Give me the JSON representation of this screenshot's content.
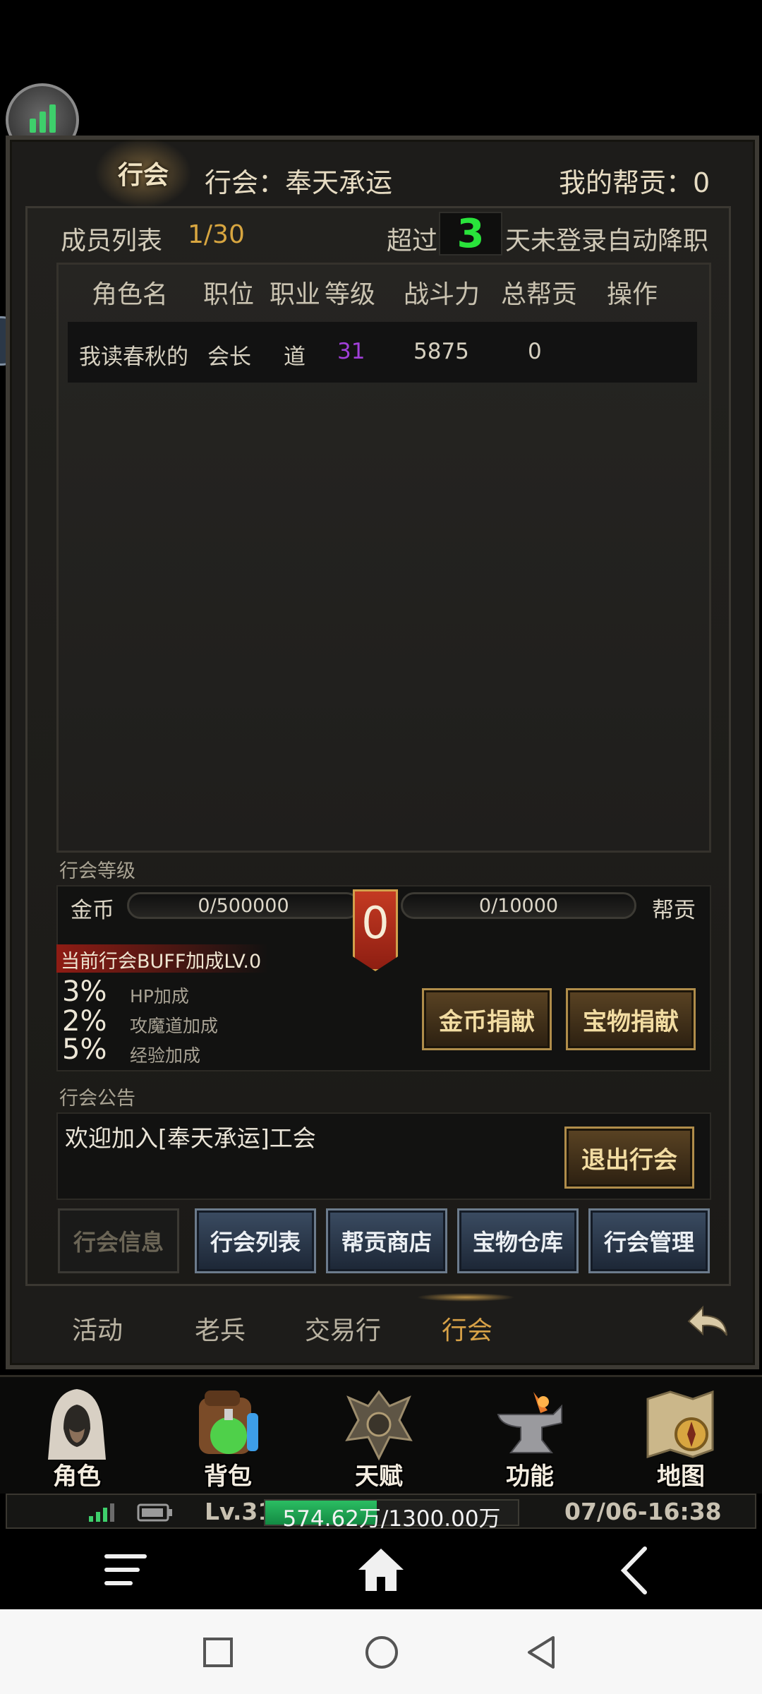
{
  "header": {
    "active_tab_badge": "行会",
    "guild_title": "行会：奉天承运",
    "my_contribution": "我的帮贡：0"
  },
  "members": {
    "label": "成员列表",
    "count": "1/30",
    "demote_prefix": "超过",
    "demote_days": "3",
    "demote_suffix": "天未登录自动降职",
    "columns": [
      "角色名",
      "职位",
      "职业",
      "等级",
      "战斗力",
      "总帮贡",
      "操作"
    ],
    "rows": [
      {
        "name": "我读春秋的",
        "position": "会长",
        "class": "道",
        "level": "31",
        "power": "5875",
        "contribution": "0"
      }
    ]
  },
  "guild_level": {
    "section_label": "行会等级",
    "gold_label": "金币",
    "gold_progress": "0/500000",
    "gold_fraction": 0,
    "contrib_label": "帮贡",
    "contrib_progress": "0/10000",
    "contrib_fraction": 0,
    "level": "0",
    "buff_title": "当前行会BUFF加成LV.0",
    "buffs": [
      {
        "pct": "3%",
        "name": "HP加成"
      },
      {
        "pct": "2%",
        "name": "攻魔道加成"
      },
      {
        "pct": "5%",
        "name": "经验加成"
      }
    ],
    "gold_donate_button": "金币捐献",
    "treasure_donate_button": "宝物捐献"
  },
  "notice": {
    "section_label": "行会公告",
    "text": "欢迎加入[奉天承运]工会",
    "leave_button": "退出行会"
  },
  "sub_tabs": [
    "行会信息",
    "行会列表",
    "帮贡商店",
    "宝物仓库",
    "行会管理"
  ],
  "bottom_tabs": [
    "活动",
    "老兵",
    "交易行",
    "行会"
  ],
  "active_bottom_tab": "行会",
  "main_menu": [
    {
      "label": "角色",
      "icon": "hooded-character-icon"
    },
    {
      "label": "背包",
      "icon": "backpack-potion-icon"
    },
    {
      "label": "天赋",
      "icon": "dragon-emblem-icon"
    },
    {
      "label": "功能",
      "icon": "anvil-icon"
    },
    {
      "label": "地图",
      "icon": "map-compass-icon"
    }
  ],
  "status": {
    "level": "Lv.31",
    "exp_text": "574.62万/1300.00万",
    "exp_fraction": 0.442,
    "datetime": "07/06-16:38"
  },
  "colors": {
    "accent_gold": "#d8a640",
    "days_green": "#29e33b",
    "level_purple": "#a13fd9",
    "exp_green": "#2bbd62"
  }
}
